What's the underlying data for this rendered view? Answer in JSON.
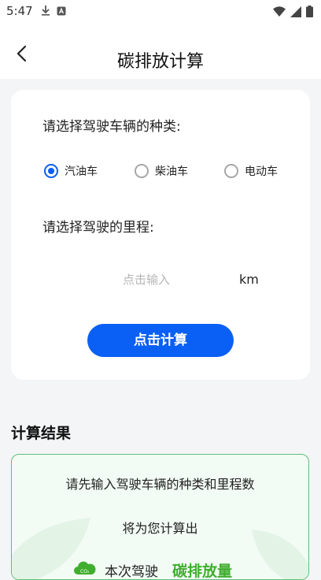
{
  "status_bar": {
    "time": "5:47"
  },
  "header": {
    "title": "碳排放计算"
  },
  "form": {
    "vehicle_label": "请选择驾驶车辆的种类:",
    "vehicle_options": [
      "汽油车",
      "柴油车",
      "电动车"
    ],
    "selected_vehicle": "汽油车",
    "mileage_label": "请选择驾驶的里程:",
    "mileage_placeholder": "点击输入",
    "mileage_value": "",
    "unit": "km",
    "calc_button": "点击计算"
  },
  "result": {
    "title": "计算结果",
    "line1": "请先输入驾驶车辆的种类和里程数",
    "line2": "将为您计算出",
    "footer_text": "本次驾驶",
    "footer_emph": "碳排放量"
  },
  "colors": {
    "accent": "#0a5ff5",
    "green": "#3fae2e"
  }
}
